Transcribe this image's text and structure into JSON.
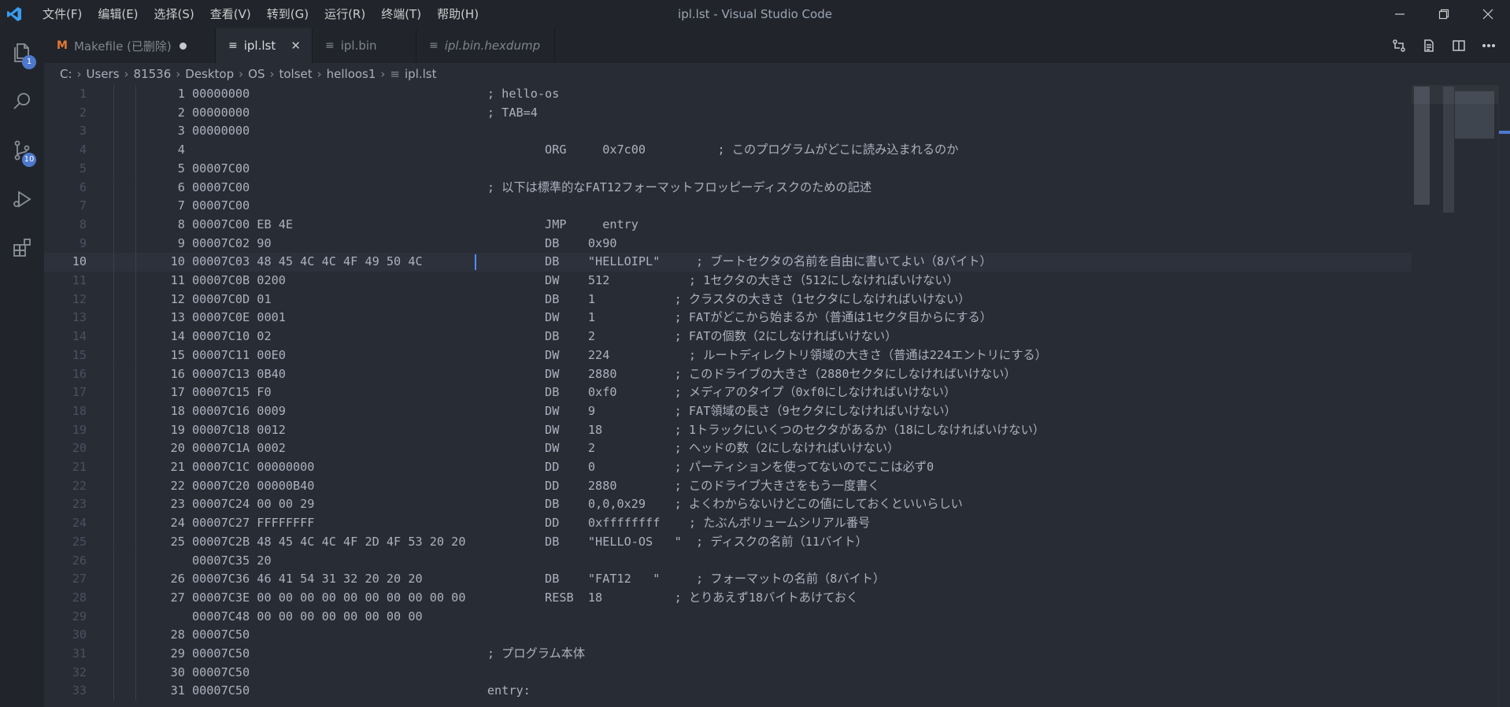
{
  "window": {
    "title": "ipl.lst - Visual Studio Code",
    "menu": [
      "文件(F)",
      "编辑(E)",
      "选择(S)",
      "查看(V)",
      "转到(G)",
      "运行(R)",
      "终端(T)",
      "帮助(H)"
    ]
  },
  "activity": {
    "explorer_badge": "1",
    "scm_badge": "10"
  },
  "tabs": [
    {
      "label": "Makefile (已删除)",
      "icon": "M",
      "modified": true
    },
    {
      "label": "ipl.lst",
      "icon": "≡",
      "active": true
    },
    {
      "label": "ipl.bin",
      "icon": "≡"
    },
    {
      "label": "ipl.bin.hexdump",
      "icon": "≡"
    }
  ],
  "breadcrumb": [
    "C:",
    "Users",
    "81536",
    "Desktop",
    "OS",
    "tolset",
    "helloos1",
    "ipl.lst"
  ],
  "editor": {
    "current_line": 10,
    "lines": [
      "     1 00000000                                 ; hello-os",
      "     2 00000000                                 ; TAB=4",
      "     3 00000000                                 ",
      "     4                                                  ORG     0x7c00          ; このプログラムがどこに読み込まれるのか",
      "     5 00007C00                                 ",
      "     6 00007C00                                 ; 以下は標準的なFAT12フォーマットフロッピーディスクのための記述",
      "     7 00007C00                                 ",
      "     8 00007C00 EB 4E                                   JMP     entry",
      "     9 00007C02 90                                      DB    0x90",
      "    10 00007C03 48 45 4C 4C 4F 49 50 4C                 DB    \"HELLOIPL\"     ; ブートセクタの名前を自由に書いてよい（8バイト）",
      "    11 00007C0B 0200                                    DW    512           ; 1セクタの大きさ（512にしなければいけない）",
      "    12 00007C0D 01                                      DB    1           ; クラスタの大きさ（1セクタにしなければいけない）",
      "    13 00007C0E 0001                                    DW    1           ; FATがどこから始まるか（普通は1セクタ目からにする）",
      "    14 00007C10 02                                      DB    2           ; FATの個数（2にしなければいけない）",
      "    15 00007C11 00E0                                    DW    224           ; ルートディレクトリ領域の大きさ（普通は224エントリにする）",
      "    16 00007C13 0B40                                    DW    2880        ; このドライブの大きさ（2880セクタにしなければいけない）",
      "    17 00007C15 F0                                      DB    0xf0        ; メディアのタイプ（0xf0にしなければいけない）",
      "    18 00007C16 0009                                    DW    9           ; FAT領域の長さ（9セクタにしなければいけない）",
      "    19 00007C18 0012                                    DW    18          ; 1トラックにいくつのセクタがあるか（18にしなければいけない）",
      "    20 00007C1A 0002                                    DW    2           ; ヘッドの数（2にしなければいけない）",
      "    21 00007C1C 00000000                                DD    0           ; パーティションを使ってないのでここは必ず0",
      "    22 00007C20 00000B40                                DD    2880        ; このドライブ大きさをもう一度書く",
      "    23 00007C24 00 00 29                                DB    0,0,0x29    ; よくわからないけどこの値にしておくといいらしい",
      "    24 00007C27 FFFFFFFF                                DD    0xffffffff    ; たぶんボリュームシリアル番号",
      "    25 00007C2B 48 45 4C 4C 4F 2D 4F 53 20 20           DB    \"HELLO-OS   \"  ; ディスクの名前（11バイト）",
      "       00007C35 20",
      "    26 00007C36 46 41 54 31 32 20 20 20                 DB    \"FAT12   \"     ; フォーマットの名前（8バイト）",
      "    27 00007C3E 00 00 00 00 00 00 00 00 00 00           RESB  18          ; とりあえず18バイトあけておく",
      "       00007C48 00 00 00 00 00 00 00 00",
      "    28 00007C50                                 ",
      "    29 00007C50                                 ; プログラム本体",
      "    30 00007C50                                 ",
      "    31 00007C50                                 entry:"
    ]
  }
}
